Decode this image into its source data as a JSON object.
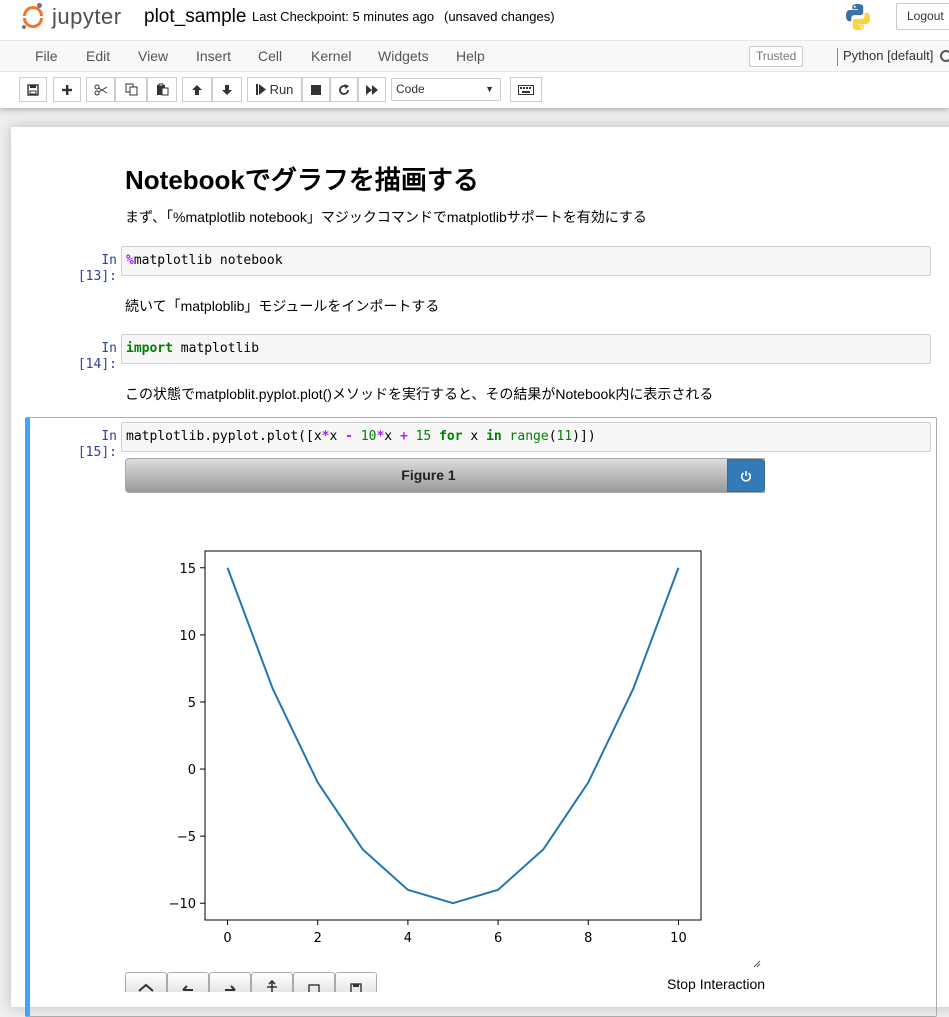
{
  "header": {
    "logo_text": "jupyter",
    "notebook_name": "plot_sample",
    "checkpoint": "Last Checkpoint: 5 minutes ago",
    "autosave": "(unsaved changes)",
    "logout_label": "Logout"
  },
  "menu": {
    "items": [
      "File",
      "Edit",
      "View",
      "Insert",
      "Cell",
      "Kernel",
      "Widgets",
      "Help"
    ],
    "trusted": "Trusted",
    "kernel": "Python [default]"
  },
  "toolbar": {
    "run_label": "Run",
    "cell_type": "Code"
  },
  "notebook": {
    "heading": "Notebookでグラフを描画する",
    "md1": "まず、「%matplotlib notebook」マジックコマンドでmatplotlibサポートを有効にする",
    "md2": "続いて「matploblib」モジュールをインポートする",
    "md3": "この状態でmatploblit.pyplot.plot()メソッドを実行すると、その結果がNotebook内に表示される",
    "cells": [
      {
        "prompt": "In [13]:",
        "code": "%matplotlib notebook"
      },
      {
        "prompt": "In [14]:",
        "code": "import matplotlib"
      },
      {
        "prompt": "In [15]:",
        "code": "matplotlib.pyplot.plot([x*x - 10*x + 15 for x in range(11)])"
      }
    ]
  },
  "figure": {
    "title": "Figure 1",
    "stop_label": "Stop Interaction"
  },
  "chart_data": {
    "type": "line",
    "x": [
      0,
      1,
      2,
      3,
      4,
      5,
      6,
      7,
      8,
      9,
      10
    ],
    "series": [
      {
        "values": [
          15,
          6,
          -1,
          -6,
          -9,
          -10,
          -9,
          -6,
          -1,
          6,
          15
        ],
        "color": "#1f77b4"
      }
    ],
    "xticks": [
      0,
      2,
      4,
      6,
      8,
      10
    ],
    "yticks": [
      15,
      10,
      5,
      0,
      -5,
      -10
    ],
    "ytick_labels": [
      "15",
      "10",
      "5",
      "0",
      "−5",
      "−10"
    ],
    "xlim": [
      -0.5,
      10.5
    ],
    "ylim": [
      -11.25,
      16.25
    ],
    "grid": false,
    "title": "",
    "xlabel": "",
    "ylabel": ""
  }
}
